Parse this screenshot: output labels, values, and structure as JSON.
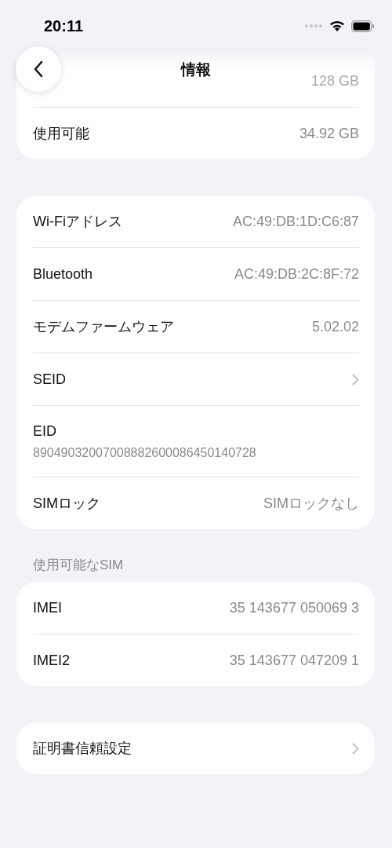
{
  "status_bar": {
    "time": "20:11"
  },
  "nav": {
    "title": "情報"
  },
  "sections": [
    {
      "rows": [
        {
          "kind": "value",
          "value": "128 GB",
          "faded": true
        },
        {
          "kind": "value",
          "label": "使用可能",
          "value": "34.92 GB",
          "faded": false
        }
      ]
    },
    {
      "rows": [
        {
          "kind": "value",
          "label": "Wi-Fiアドレス",
          "value": "AC:49:DB:1D:C6:87",
          "faded": false
        },
        {
          "kind": "value",
          "label": "Bluetooth",
          "value": "AC:49:DB:2C:8F:72",
          "faded": false
        },
        {
          "kind": "value",
          "label": "モデムファームウェア",
          "value": "5.02.02",
          "faded": false
        },
        {
          "kind": "link",
          "label": "SEID"
        },
        {
          "kind": "stacked",
          "label": "EID",
          "value": "89049032007008882600086450140728"
        },
        {
          "kind": "value",
          "label": "SIMロック",
          "value": "SIMロックなし",
          "faded": false
        }
      ]
    },
    {
      "header": "使用可能なSIM",
      "rows": [
        {
          "kind": "value",
          "label": "IMEI",
          "value": "35 143677 050069 3",
          "faded": false
        },
        {
          "kind": "value",
          "label": "IMEI2",
          "value": "35 143677 047209 1",
          "faded": false
        }
      ]
    },
    {
      "rows": [
        {
          "kind": "link",
          "label": "証明書信頼設定"
        }
      ]
    }
  ]
}
